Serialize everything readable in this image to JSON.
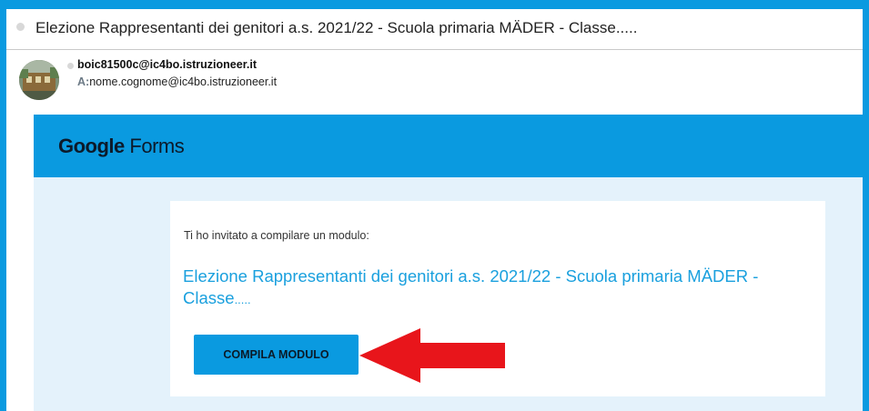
{
  "email": {
    "subject": "Elezione Rappresentanti dei genitori a.s. 2021/22 - Scuola primaria MÄDER - Classe.....",
    "sender": "boic81500c@ic4bo.istruzioneer.it",
    "recipient_label": "A:",
    "recipient": "nome.cognome@ic4bo.istruzioneer.it"
  },
  "forms": {
    "logo_google": "Google",
    "logo_forms": "Forms",
    "invite_text": "Ti ho invitato a compilare un modulo:",
    "form_title": "Elezione Rappresentanti dei genitori a.s. 2021/22 - Scuola primaria MÄDER - Classe",
    "form_title_ellipsis": ".....",
    "button_label": "COMPILA MODULO"
  },
  "colors": {
    "accent": "#0a9ae0",
    "body_background": "#e4f2fb",
    "title_link": "#1aa0de",
    "arrow": "#e8151b"
  },
  "icons": {
    "unread_dot": "dot-icon",
    "avatar": "avatar-photo",
    "pointer_arrow": "left-arrow-icon"
  }
}
